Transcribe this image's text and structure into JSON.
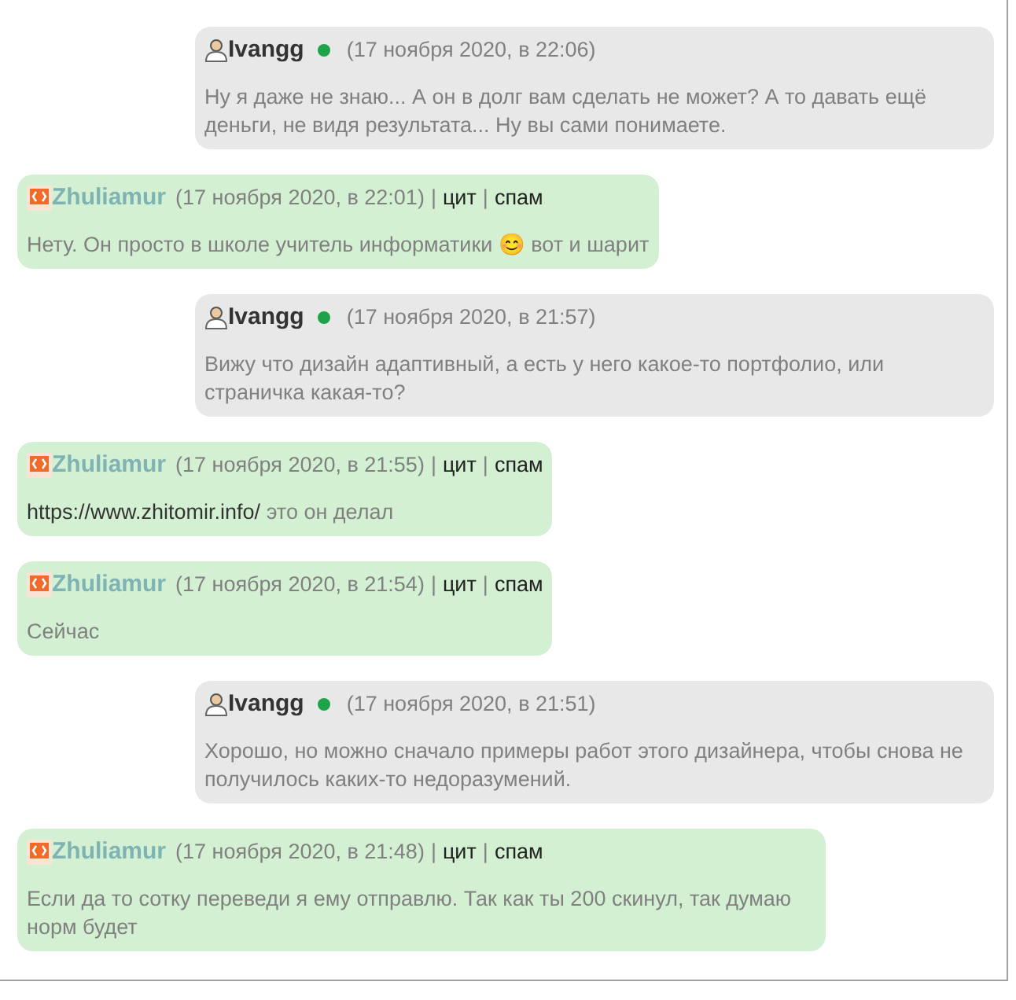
{
  "messages": [
    {
      "kind": "other",
      "author": "Ivangg",
      "online": true,
      "time": "(17 ноября 2020, в 22:06)",
      "text": "Ну я даже не знаю... А он в долг вам сделать не может? А то давать ещё деньги, не видя результата... Ну вы сами понимаете."
    },
    {
      "kind": "own",
      "author": "Zhuliamur",
      "time": "(17 ноября 2020, в 22:01)",
      "separator": "|",
      "actions": [
        "цит",
        "спам"
      ],
      "text": "Нету. Он просто в школе учитель информатики 😊 вот и шарит"
    },
    {
      "kind": "other",
      "author": "Ivangg",
      "online": true,
      "time": "(17 ноября 2020, в 21:57)",
      "text": "Вижу что дизайн адаптивный, а есть у него какое-то портфолио, или страничка какая-то?"
    },
    {
      "kind": "own",
      "author": "Zhuliamur",
      "time": "(17 ноября 2020, в 21:55)",
      "separator": "|",
      "actions": [
        "цит",
        "спам"
      ],
      "link": "https://www.zhitomir.info/",
      "text": "это он делал"
    },
    {
      "kind": "own",
      "author": "Zhuliamur",
      "time": "(17 ноября 2020, в 21:54)",
      "separator": "|",
      "actions": [
        "цит",
        "спам"
      ],
      "text": "Сейчас"
    },
    {
      "kind": "other",
      "author": "Ivangg",
      "online": true,
      "time": "(17 ноября 2020, в 21:51)",
      "text": "Хорошо, но можно сначало примеры работ этого дизайнера, чтобы снова не получилось каких-то недоразумений."
    },
    {
      "kind": "own",
      "author": "Zhuliamur",
      "time": "(17 ноября 2020, в 21:48)",
      "separator": "|",
      "actions": [
        "цит",
        "спам"
      ],
      "text": "Если да то сотку переведи я ему отправлю. Так как ты 200 скинул, так думаю норм будет"
    }
  ]
}
